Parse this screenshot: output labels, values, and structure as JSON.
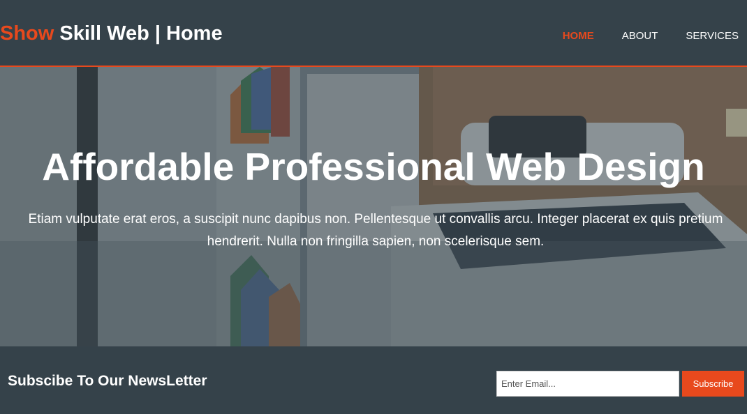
{
  "header": {
    "brand_highlight": "Show",
    "brand_rest": " Skill Web | Home",
    "nav": [
      {
        "label": "HOME",
        "current": true
      },
      {
        "label": "ABOUT",
        "current": false
      },
      {
        "label": "SERVICES",
        "current": false
      }
    ]
  },
  "showcase": {
    "title": "Affordable Professional Web Design",
    "text": "Etiam vulputate erat eros, a suscipit nunc dapibus non. Pellentesque ut convallis arcu. Integer placerat ex quis pretium hendrerit. Nulla non fringilla sapien, non scelerisque sem."
  },
  "newsletter": {
    "heading": "Subscibe To Our NewsLetter",
    "email_placeholder": "Enter Email...",
    "email_value": "",
    "button_label": "Subscribe"
  },
  "colors": {
    "accent": "#e8491d",
    "dark": "#35424a",
    "text": "#ffffff"
  }
}
